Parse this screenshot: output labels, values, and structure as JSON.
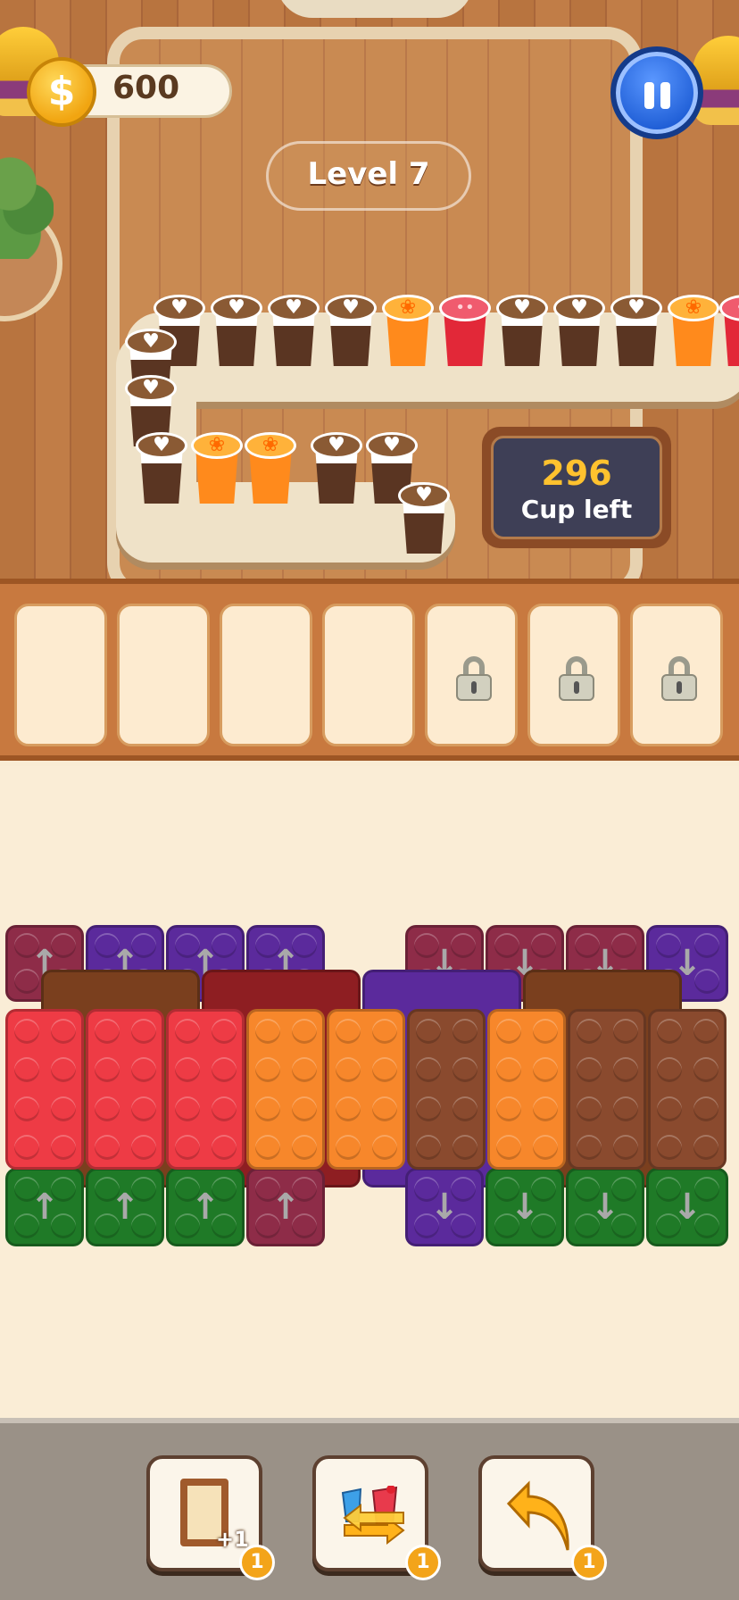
{
  "hud": {
    "coins": "600",
    "coin_symbol": "$",
    "level": "Level 7",
    "cups_left_count": "296",
    "cups_left_label": "Cup left"
  },
  "conveyor": {
    "cups": [
      {
        "type": "coffee"
      },
      {
        "type": "coffee"
      },
      {
        "type": "coffee"
      },
      {
        "type": "coffee"
      },
      {
        "type": "orange"
      },
      {
        "type": "berry"
      },
      {
        "type": "coffee"
      },
      {
        "type": "coffee"
      },
      {
        "type": "coffee"
      },
      {
        "type": "orange"
      },
      {
        "type": "berry"
      },
      {
        "type": "coffee"
      },
      {
        "type": "coffee"
      },
      {
        "type": "coffee"
      },
      {
        "type": "orange"
      },
      {
        "type": "orange"
      },
      {
        "type": "coffee"
      },
      {
        "type": "coffee"
      },
      {
        "type": "coffee"
      }
    ]
  },
  "slots": [
    {
      "locked": false
    },
    {
      "locked": false
    },
    {
      "locked": false
    },
    {
      "locked": false
    },
    {
      "locked": true
    },
    {
      "locked": true
    },
    {
      "locked": true
    }
  ],
  "colors": {
    "maroon": "#8e2c48",
    "purple": "#5b2a9c",
    "brown": "#7a3f1e",
    "darkred": "#8e1e22",
    "red": "#ee3b45",
    "orange": "#f7872b",
    "brick_brown": "#8a4a2e",
    "green": "#1f7a27"
  },
  "toolbar": {
    "tools": [
      {
        "name": "add-slot",
        "plus_label": "+1",
        "count": "1"
      },
      {
        "name": "shuffle",
        "count": "1"
      },
      {
        "name": "undo-arrow",
        "count": "1"
      }
    ]
  }
}
